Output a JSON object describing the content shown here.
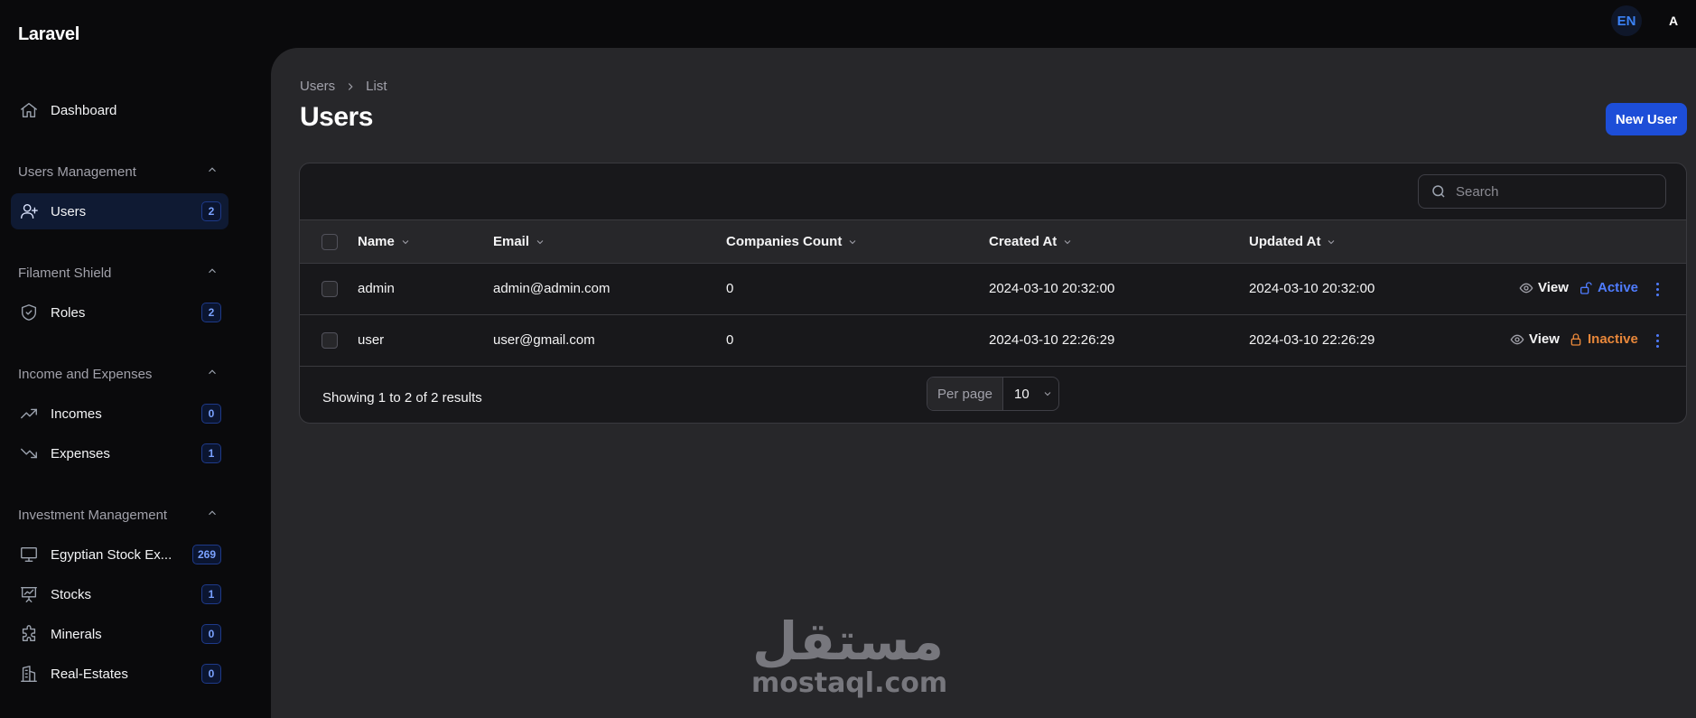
{
  "brand": "Laravel",
  "topbar": {
    "lang": "EN",
    "avatar": "A"
  },
  "sidebar": {
    "dashboard": {
      "label": "Dashboard",
      "icon": "home-icon"
    },
    "groups": [
      {
        "title": "Users Management",
        "items": [
          {
            "label": "Users",
            "badge": "2",
            "icon": "user-plus-icon",
            "active": true
          }
        ]
      },
      {
        "title": "Filament Shield",
        "items": [
          {
            "label": "Roles",
            "badge": "2",
            "icon": "shield-check-icon"
          }
        ]
      },
      {
        "title": "Income and Expenses",
        "items": [
          {
            "label": "Incomes",
            "badge": "0",
            "icon": "trending-up-icon"
          },
          {
            "label": "Expenses",
            "badge": "1",
            "icon": "trending-down-icon"
          }
        ]
      },
      {
        "title": "Investment Management",
        "items": [
          {
            "label": "Egyptian Stock Ex...",
            "badge": "269",
            "icon": "monitor-icon"
          },
          {
            "label": "Stocks",
            "badge": "1",
            "icon": "presentation-chart-icon"
          },
          {
            "label": "Minerals",
            "badge": "0",
            "icon": "puzzle-icon"
          },
          {
            "label": "Real-Estates",
            "badge": "0",
            "icon": "building-icon"
          }
        ]
      }
    ]
  },
  "breadcrumb": [
    "Users",
    "List"
  ],
  "page": {
    "title": "Users",
    "new_button": "New User"
  },
  "table": {
    "search_placeholder": "Search",
    "columns": [
      "Name",
      "Email",
      "Companies Count",
      "Created At",
      "Updated At"
    ],
    "rows": [
      {
        "name": "admin",
        "email": "admin@admin.com",
        "companies": "0",
        "created": "2024-03-10 20:32:00",
        "updated": "2024-03-10 20:32:00",
        "view": "View",
        "status": "Active"
      },
      {
        "name": "user",
        "email": "user@gmail.com",
        "companies": "0",
        "created": "2024-03-10 22:26:29",
        "updated": "2024-03-10 22:26:29",
        "view": "View",
        "status": "Inactive"
      }
    ],
    "footer": {
      "summary": "Showing 1 to 2 of 2 results",
      "per_page_label": "Per page",
      "per_page_value": "10"
    }
  },
  "colors": {
    "accent": "#1d4ed8",
    "active_status": "#4f7cff",
    "inactive_status": "#e8873a",
    "panel": "#27272a",
    "card": "#18181b"
  },
  "watermark": {
    "arabic": "مستقل",
    "latin": "mostaql.com"
  }
}
